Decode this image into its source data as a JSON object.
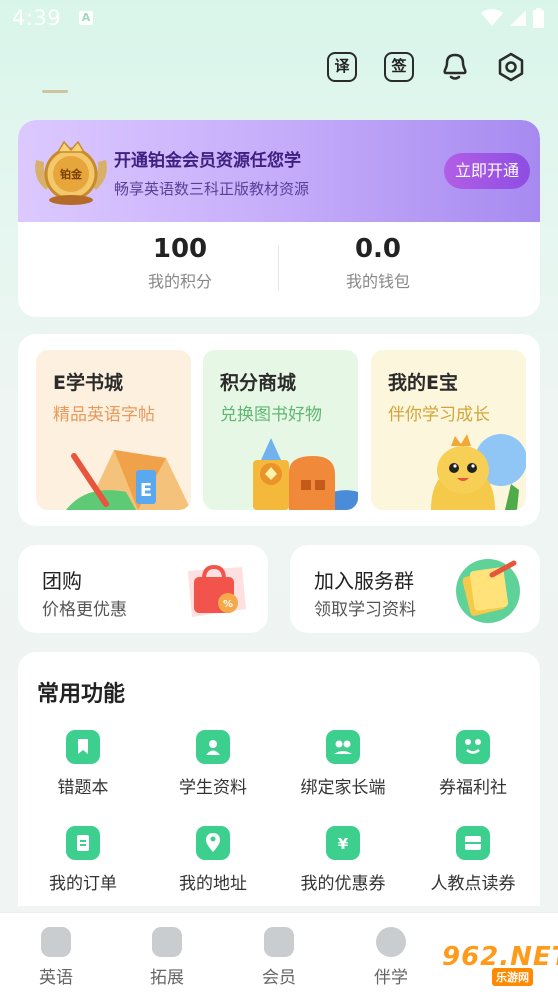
{
  "status_bar": {
    "time": "4:39",
    "a_badge": "A"
  },
  "toolbar": {
    "translate_label": "译",
    "signin_label": "签"
  },
  "member": {
    "badge_text": "铂金",
    "title": "开通铂金会员资源任您学",
    "subtitle": "畅享英语数三科正版教材资源",
    "button": "立即开通"
  },
  "stats": [
    {
      "value": "100",
      "label": "我的积分"
    },
    {
      "value": "0.0",
      "label": "我的钱包"
    }
  ],
  "features": [
    {
      "title": "E学书城",
      "subtitle": "精品英语字帖",
      "bg": "#fdf0df",
      "sub_color": "#e69a5c"
    },
    {
      "title": "积分商城",
      "subtitle": "兑换图书好物",
      "bg": "#e6f7e6",
      "sub_color": "#5fb872"
    },
    {
      "title": "我的E宝",
      "subtitle": "伴你学习成长",
      "bg": "#fbf6dc",
      "sub_color": "#d2a53a"
    }
  ],
  "group_buy": {
    "title": "团购",
    "subtitle": "价格更优惠"
  },
  "service_group": {
    "title": "加入服务群",
    "subtitle": "领取学习资料"
  },
  "functions": {
    "title": "常用功能",
    "items": [
      {
        "label": "错题本",
        "icon": "bookmark-icon"
      },
      {
        "label": "学生资料",
        "icon": "folder-user-icon"
      },
      {
        "label": "绑定家长端",
        "icon": "parents-icon"
      },
      {
        "label": "券福利社",
        "icon": "frog-icon"
      },
      {
        "label": "我的订单",
        "icon": "clipboard-icon"
      },
      {
        "label": "我的地址",
        "icon": "location-icon"
      },
      {
        "label": "我的优惠券",
        "icon": "coupon-icon"
      },
      {
        "label": "人教点读券",
        "icon": "ticket-icon"
      }
    ]
  },
  "bottom_nav": [
    {
      "label": "英语",
      "icon": "english-icon"
    },
    {
      "label": "拓展",
      "icon": "star-book-icon"
    },
    {
      "label": "会员",
      "icon": "crown-icon"
    },
    {
      "label": "伴学",
      "icon": "companion-icon"
    }
  ],
  "watermark": {
    "main": "962.NET",
    "sub": "乐游网"
  },
  "colors": {
    "accent": "#3dcf8e",
    "member_purple": "#a78af0",
    "button_purple": "#9b55e4"
  }
}
